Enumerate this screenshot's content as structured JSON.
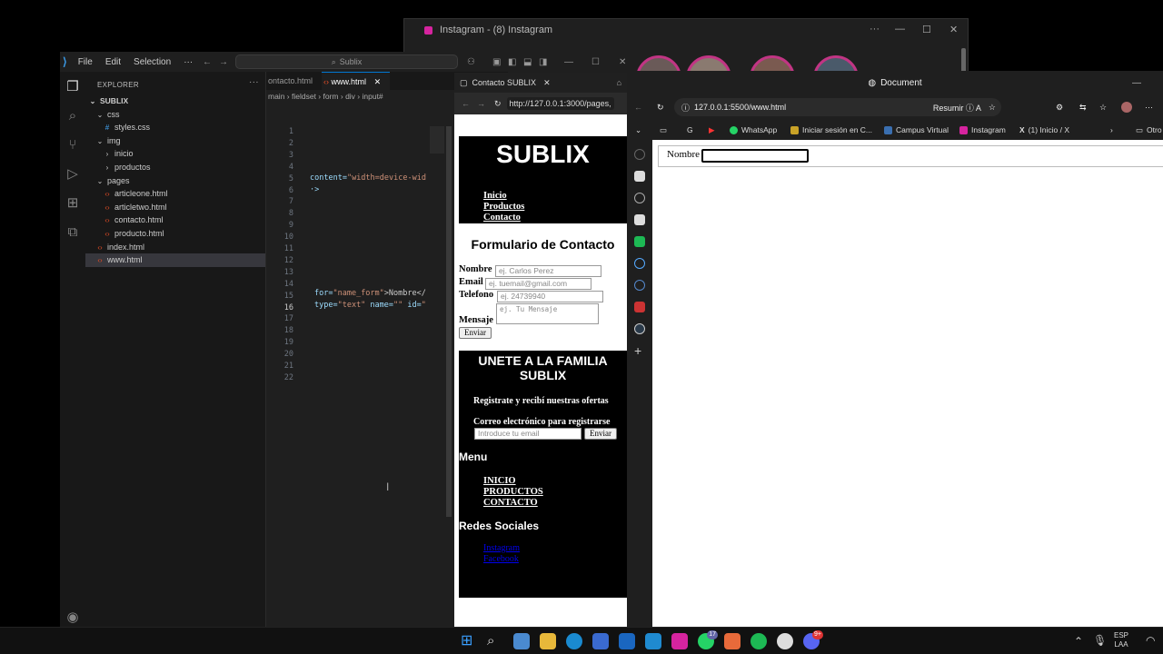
{
  "instagram": {
    "title": "Instagram - (8) Instagram"
  },
  "vscode": {
    "menu": [
      "File",
      "Edit",
      "Selection",
      "···"
    ],
    "command_center": "Sublix",
    "explorer_title": "EXPLORER",
    "root": "SUBLIX",
    "tree": [
      {
        "label": "css",
        "kind": "folder-open",
        "indent": 1
      },
      {
        "label": "styles.css",
        "kind": "css",
        "indent": 2
      },
      {
        "label": "img",
        "kind": "folder-open",
        "indent": 1
      },
      {
        "label": "inicio",
        "kind": "folder",
        "indent": 2
      },
      {
        "label": "productos",
        "kind": "folder",
        "indent": 2
      },
      {
        "label": "pages",
        "kind": "folder-open",
        "indent": 1
      },
      {
        "label": "articleone.html",
        "kind": "html",
        "indent": 2
      },
      {
        "label": "articletwo.html",
        "kind": "html",
        "indent": 2
      },
      {
        "label": "contacto.html",
        "kind": "html",
        "indent": 2
      },
      {
        "label": "producto.html",
        "kind": "html",
        "indent": 2
      },
      {
        "label": "index.html",
        "kind": "html",
        "indent": 1
      },
      {
        "label": "www.html",
        "kind": "html",
        "indent": 1,
        "selected": true
      }
    ],
    "tabs": [
      "ontacto.html",
      "www.html"
    ],
    "breadcrumb": [
      "main",
      "fieldset",
      "form",
      "div",
      "input#"
    ],
    "line_numbers": [
      "1",
      "2",
      "3",
      "4",
      "5",
      "6",
      "7",
      "8",
      "9",
      "10",
      "11",
      "12",
      "13",
      "14",
      "15",
      "16",
      "17",
      "18",
      "19",
      "20",
      "21",
      "22"
    ],
    "current_line": "16",
    "code": {
      "line5_attr": "content=",
      "line5_val": "\"width=device-wid",
      "line6": "·>",
      "line15_attr": "for=",
      "line15_val": "\"name_form\"",
      "line15_text": ">Nombre</",
      "line16_attr1": "type=",
      "line16_val1": "\"text\"",
      "line16_attr2": " name=",
      "line16_val2": "\"\"",
      "line16_attr3": " id=",
      "line16_val3": "\""
    }
  },
  "browser1": {
    "tab_title": "Contacto SUBLIX",
    "url": "http://127.0.0.1:3000/pages,",
    "header_title": "SUBLIX",
    "nav": [
      "Inicio",
      "Productos",
      "Contacto"
    ],
    "form_title": "Formulario de Contacto",
    "fields": [
      {
        "label": "Nombre",
        "placeholder": "ej. Carlos Perez"
      },
      {
        "label": "Email",
        "placeholder": "ej. tuemail@gmail.com"
      },
      {
        "label": "Telefono",
        "placeholder": "ej. 24739940"
      },
      {
        "label": "Mensaje",
        "placeholder": "ej. Tu Mensaje"
      }
    ],
    "submit": "Enviar",
    "footer": {
      "join_title": "UNETE A LA FAMILIA SUBLIX",
      "offers": "Registrate y recibí nuestras ofertas",
      "email_label": "Correo electrónico para registrarse",
      "email_placeholder": "Introduce tu email",
      "email_button": "Enviar",
      "menu_title": "Menu",
      "menu_items": [
        "INICIO",
        "PRODUCTOS",
        "CONTACTO"
      ],
      "social_title": "Redes Sociales",
      "social_links": [
        "Instagram",
        "Facebook"
      ]
    }
  },
  "browser2": {
    "title": "Document",
    "url": "127.0.0.1:5500/www.html",
    "summarize": "Resumir",
    "favorites": [
      "WhatsApp",
      "Iniciar sesión en C...",
      "Campus Virtual",
      "Instagram",
      "(1) Inicio / X",
      "Otro"
    ],
    "page_label": "Nombre"
  },
  "taskbar": {
    "lang": "ESP",
    "region": "LAA",
    "badge_whatsapp": "17",
    "badge_discord": "9+"
  },
  "colors": {
    "vscode_bg": "#1f1f1f",
    "accent": "#0078d4",
    "page_black": "#000000"
  }
}
